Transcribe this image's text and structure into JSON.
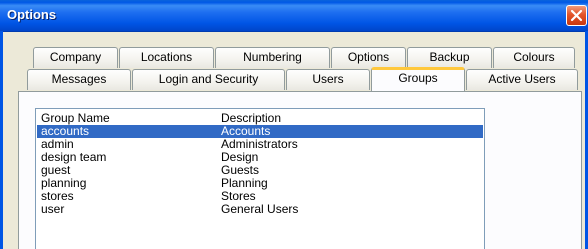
{
  "window": {
    "title": "Options"
  },
  "tabs_row1": [
    "Company",
    "Locations",
    "Numbering",
    "Options",
    "Backup",
    "Colours"
  ],
  "tabs_row2": [
    "Messages",
    "Login and Security",
    "Users",
    "Groups",
    "Active Users"
  ],
  "active_tab": "Groups",
  "list": {
    "headers": [
      "Group Name",
      "Description"
    ],
    "rows": [
      [
        "accounts",
        "Accounts"
      ],
      [
        "admin",
        "Administrators"
      ],
      [
        "design team",
        "Design"
      ],
      [
        "guest",
        "Guests"
      ],
      [
        "planning",
        "Planning"
      ],
      [
        "stores",
        "Stores"
      ],
      [
        "user",
        "General Users"
      ]
    ],
    "selected_row": "accounts"
  },
  "colors": {
    "titlebar": "#0055e5",
    "selection": "#316ac5",
    "active_tab_accent": "#ffc83c",
    "close_button": "#e3542a"
  }
}
